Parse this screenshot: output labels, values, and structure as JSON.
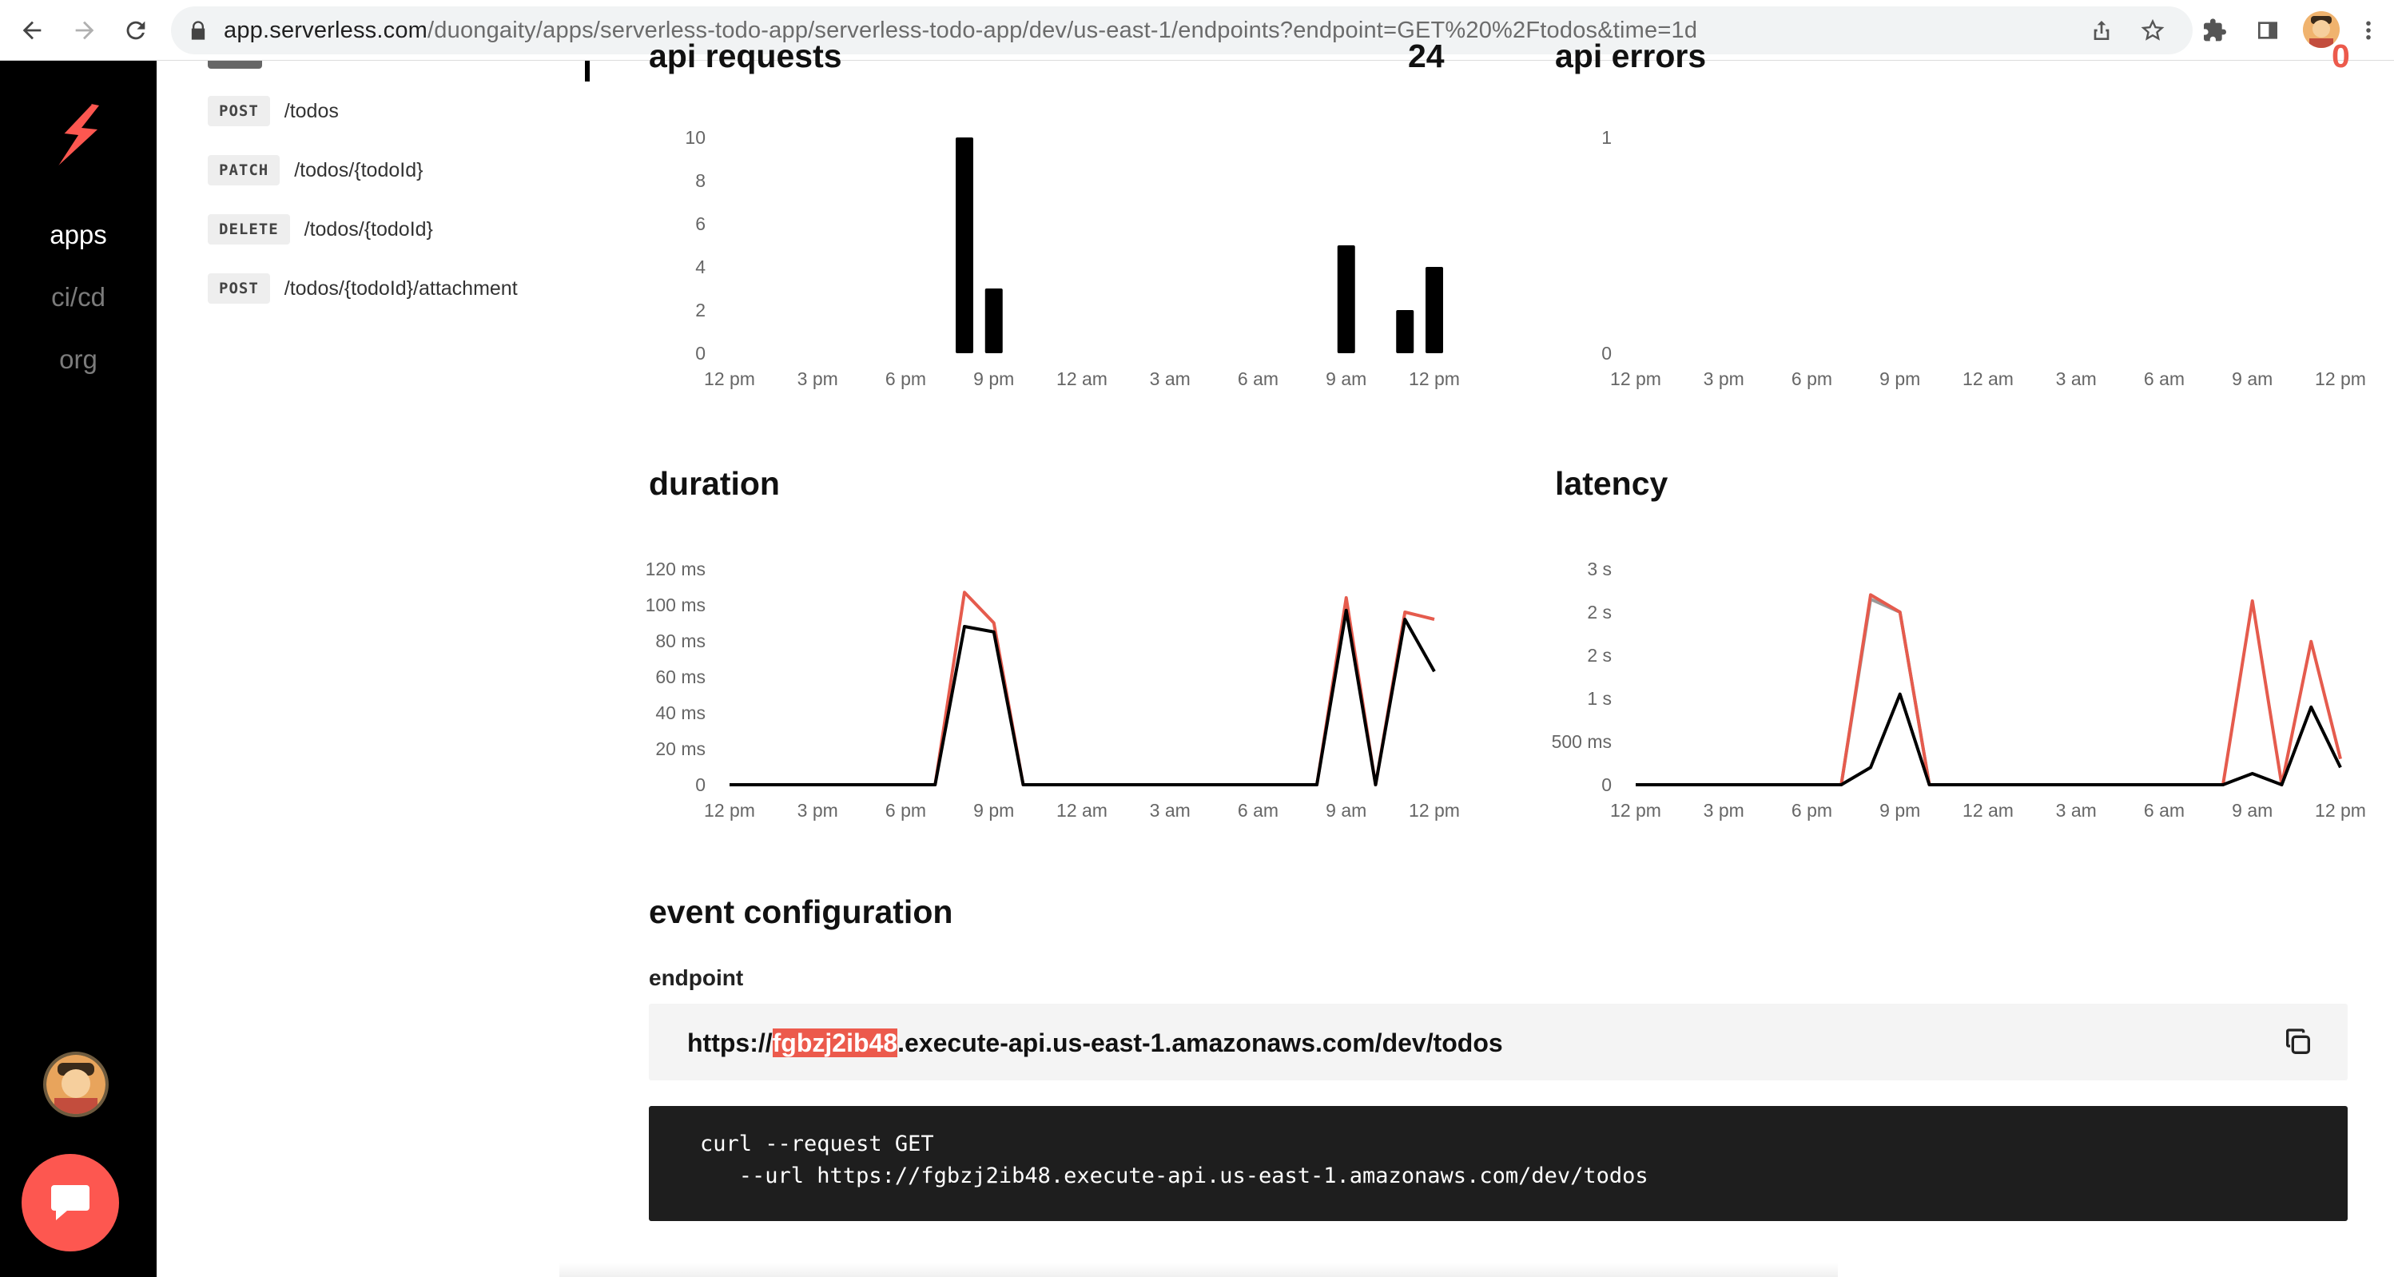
{
  "browser": {
    "url_host": "app.serverless.com",
    "url_path": "/duongaity/apps/serverless-todo-app/serverless-todo-app/dev/us-east-1/endpoints?endpoint=GET%20%2Ftodos&time=1d",
    "icons": [
      "back-icon",
      "forward-icon",
      "reload-icon",
      "lock-icon",
      "share-icon",
      "star-icon",
      "extensions-icon",
      "side-panel-icon",
      "profile-avatar",
      "kebab-menu-icon"
    ]
  },
  "rail": {
    "items": [
      {
        "label": "apps",
        "active": true
      },
      {
        "label": "ci/cd",
        "active": false
      },
      {
        "label": "org",
        "active": false
      }
    ],
    "colors": {
      "background": "#000000",
      "active": "#ffffff",
      "inactive": "#7b7b7b",
      "chat": "#fd5750"
    }
  },
  "endpoints": [
    {
      "method": "POST",
      "path": "/todos"
    },
    {
      "method": "PATCH",
      "path": "/todos/{todoId}"
    },
    {
      "method": "DELETE",
      "path": "/todos/{todoId}"
    },
    {
      "method": "POST",
      "path": "/todos/{todoId}/attachment"
    }
  ],
  "charts": {
    "api_requests": {
      "title": "api requests",
      "total": "24"
    },
    "api_errors": {
      "title": "api errors",
      "total": "0"
    },
    "duration": {
      "title": "duration"
    },
    "latency": {
      "title": "latency"
    }
  },
  "chart_data": [
    {
      "type": "bar",
      "title": "api requests",
      "x_ticks": [
        "12 pm",
        "3 pm",
        "6 pm",
        "9 pm",
        "12 am",
        "3 am",
        "6 am",
        "9 am",
        "12 pm"
      ],
      "y_ticks": [
        "0",
        "2",
        "4",
        "6",
        "8",
        "10"
      ],
      "ylim": [
        0,
        10
      ],
      "x_unit": "hours since first tick",
      "bars": [
        {
          "x": 8.0,
          "value": 10
        },
        {
          "x": 9.0,
          "value": 3
        },
        {
          "x": 21.0,
          "value": 5
        },
        {
          "x": 23.0,
          "value": 2
        },
        {
          "x": 24.0,
          "value": 4
        }
      ],
      "color": "#000000"
    },
    {
      "type": "bar",
      "title": "api errors",
      "x_ticks": [
        "12 pm",
        "3 pm",
        "6 pm",
        "9 pm",
        "12 am",
        "3 am",
        "6 am",
        "9 am",
        "12 pm"
      ],
      "y_ticks": [
        "0",
        "1"
      ],
      "ylim": [
        0,
        1
      ],
      "bars": [],
      "total_color": "#ec5a4c"
    },
    {
      "type": "line",
      "title": "duration",
      "x_ticks": [
        "12 pm",
        "3 pm",
        "6 pm",
        "9 pm",
        "12 am",
        "3 am",
        "6 am",
        "9 am",
        "12 pm"
      ],
      "y_ticks": [
        "0",
        "20 ms",
        "40 ms",
        "60 ms",
        "80 ms",
        "100 ms",
        "120 ms"
      ],
      "ylim": [
        0,
        120
      ],
      "series": [
        {
          "color": "#e55b4d",
          "x": [
            0,
            7,
            8,
            9,
            10,
            20,
            21,
            22,
            23,
            24
          ],
          "values": [
            0,
            0,
            107,
            90,
            0,
            0,
            104,
            0,
            96,
            92
          ]
        },
        {
          "color": "#000000",
          "x": [
            0,
            7,
            8,
            9,
            10,
            20,
            21,
            22,
            23,
            24
          ],
          "values": [
            0,
            0,
            88,
            85,
            0,
            0,
            97,
            0,
            92,
            63
          ]
        }
      ]
    },
    {
      "type": "line",
      "title": "latency",
      "x_ticks": [
        "12 pm",
        "3 pm",
        "6 pm",
        "9 pm",
        "12 am",
        "3 am",
        "6 am",
        "9 am",
        "12 pm"
      ],
      "y_ticks": [
        "0",
        "500 ms",
        "1 s",
        "2 s",
        "2 s",
        "3 s"
      ],
      "ylim": [
        0,
        2500
      ],
      "series": [
        {
          "color": "#999999",
          "x": [
            0,
            7,
            8,
            9,
            10
          ],
          "values": [
            0,
            0,
            2150,
            2000,
            0
          ]
        },
        {
          "color": "#e55b4d",
          "x": [
            0,
            7,
            8,
            9,
            10,
            20,
            21,
            22,
            23,
            24
          ],
          "values": [
            0,
            0,
            2200,
            2000,
            0,
            0,
            2130,
            0,
            1660,
            300
          ]
        },
        {
          "color": "#000000",
          "x": [
            0,
            7,
            8,
            9,
            10,
            20,
            21,
            22,
            23,
            24
          ],
          "values": [
            0,
            0,
            200,
            1050,
            0,
            0,
            130,
            0,
            900,
            200
          ]
        }
      ]
    }
  ],
  "event_configuration": {
    "title": "event configuration",
    "endpoint_label": "endpoint",
    "url_prefix": "https://",
    "url_highlight": "fgbzj2ib48",
    "url_suffix": ".execute-api.us-east-1.amazonaws.com/dev/todos",
    "curl_line1": "curl --request GET",
    "curl_line2": "   --url https://fgbzj2ib48.execute-api.us-east-1.amazonaws.com/dev/todos"
  }
}
